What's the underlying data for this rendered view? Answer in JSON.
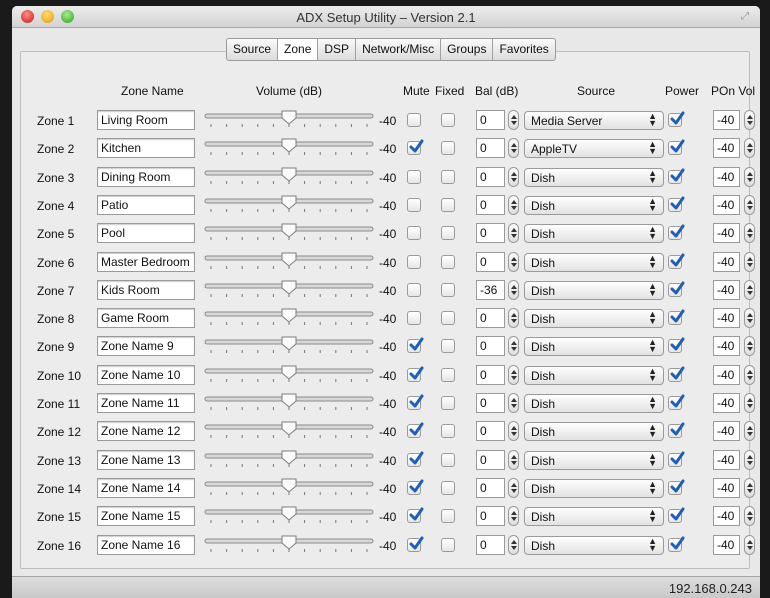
{
  "window": {
    "title": "ADX Setup Utility – Version 2.1"
  },
  "tabs": [
    {
      "label": "Source",
      "active": false
    },
    {
      "label": "Zone",
      "active": true
    },
    {
      "label": "DSP",
      "active": false
    },
    {
      "label": "Network/Misc",
      "active": false
    },
    {
      "label": "Groups",
      "active": false
    },
    {
      "label": "Favorites",
      "active": false
    }
  ],
  "headers": {
    "zone_name": "Zone Name",
    "volume": "Volume (dB)",
    "mute": "Mute",
    "fixed": "Fixed",
    "bal": "Bal (dB)",
    "source": "Source",
    "power": "Power",
    "pon_vol": "POn Vol"
  },
  "zones": [
    {
      "label": "Zone 1",
      "name": "Living Room",
      "volume": "-40",
      "volume_fraction": 0.5,
      "mute": false,
      "fixed": false,
      "bal": "0",
      "source": "Media Server",
      "power": true,
      "pon_vol": "-40"
    },
    {
      "label": "Zone 2",
      "name": "Kitchen",
      "volume": "-40",
      "volume_fraction": 0.5,
      "mute": true,
      "fixed": false,
      "bal": "0",
      "source": "AppleTV",
      "power": true,
      "pon_vol": "-40"
    },
    {
      "label": "Zone 3",
      "name": "Dining Room",
      "volume": "-40",
      "volume_fraction": 0.5,
      "mute": false,
      "fixed": false,
      "bal": "0",
      "source": "Dish",
      "power": true,
      "pon_vol": "-40"
    },
    {
      "label": "Zone 4",
      "name": "Patio",
      "volume": "-40",
      "volume_fraction": 0.5,
      "mute": false,
      "fixed": false,
      "bal": "0",
      "source": "Dish",
      "power": true,
      "pon_vol": "-40"
    },
    {
      "label": "Zone 5",
      "name": "Pool",
      "volume": "-40",
      "volume_fraction": 0.5,
      "mute": false,
      "fixed": false,
      "bal": "0",
      "source": "Dish",
      "power": true,
      "pon_vol": "-40"
    },
    {
      "label": "Zone 6",
      "name": "Master Bedroom",
      "volume": "-40",
      "volume_fraction": 0.5,
      "mute": false,
      "fixed": false,
      "bal": "0",
      "source": "Dish",
      "power": true,
      "pon_vol": "-40"
    },
    {
      "label": "Zone 7",
      "name": "Kids Room",
      "volume": "-40",
      "volume_fraction": 0.5,
      "mute": false,
      "fixed": false,
      "bal": "-36",
      "source": "Dish",
      "power": true,
      "pon_vol": "-40"
    },
    {
      "label": "Zone 8",
      "name": "Game Room",
      "volume": "-40",
      "volume_fraction": 0.5,
      "mute": false,
      "fixed": false,
      "bal": "0",
      "source": "Dish",
      "power": true,
      "pon_vol": "-40"
    },
    {
      "label": "Zone 9",
      "name": "Zone Name 9",
      "volume": "-40",
      "volume_fraction": 0.5,
      "mute": true,
      "fixed": false,
      "bal": "0",
      "source": "Dish",
      "power": true,
      "pon_vol": "-40"
    },
    {
      "label": "Zone 10",
      "name": "Zone Name 10",
      "volume": "-40",
      "volume_fraction": 0.5,
      "mute": true,
      "fixed": false,
      "bal": "0",
      "source": "Dish",
      "power": true,
      "pon_vol": "-40"
    },
    {
      "label": "Zone 11",
      "name": "Zone Name 11",
      "volume": "-40",
      "volume_fraction": 0.5,
      "mute": true,
      "fixed": false,
      "bal": "0",
      "source": "Dish",
      "power": true,
      "pon_vol": "-40"
    },
    {
      "label": "Zone 12",
      "name": "Zone Name 12",
      "volume": "-40",
      "volume_fraction": 0.5,
      "mute": true,
      "fixed": false,
      "bal": "0",
      "source": "Dish",
      "power": true,
      "pon_vol": "-40"
    },
    {
      "label": "Zone 13",
      "name": "Zone Name 13",
      "volume": "-40",
      "volume_fraction": 0.5,
      "mute": true,
      "fixed": false,
      "bal": "0",
      "source": "Dish",
      "power": true,
      "pon_vol": "-40"
    },
    {
      "label": "Zone 14",
      "name": "Zone Name 14",
      "volume": "-40",
      "volume_fraction": 0.5,
      "mute": true,
      "fixed": false,
      "bal": "0",
      "source": "Dish",
      "power": true,
      "pon_vol": "-40"
    },
    {
      "label": "Zone 15",
      "name": "Zone Name 15",
      "volume": "-40",
      "volume_fraction": 0.5,
      "mute": true,
      "fixed": false,
      "bal": "0",
      "source": "Dish",
      "power": true,
      "pon_vol": "-40"
    },
    {
      "label": "Zone 16",
      "name": "Zone Name 16",
      "volume": "-40",
      "volume_fraction": 0.5,
      "mute": true,
      "fixed": false,
      "bal": "0",
      "source": "Dish",
      "power": true,
      "pon_vol": "-40"
    }
  ],
  "status": {
    "ip": "192.168.0.243"
  },
  "colors": {
    "checkmark": "#1f5fb8",
    "window_bg": "#e8e8e8"
  },
  "icons": {
    "select": "updown-arrows-icon",
    "check": "checkmark-icon",
    "resize": "fullscreen-icon"
  }
}
